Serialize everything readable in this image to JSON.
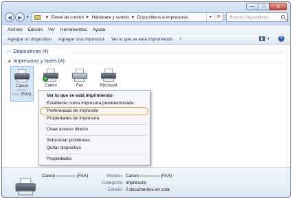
{
  "window": {
    "controls": {
      "minimize": "—",
      "maximize": "□",
      "close": "✕"
    }
  },
  "nav": {
    "back_icon": "back-arrow-icon",
    "forward_icon": "forward-arrow-icon",
    "breadcrumb": [
      "Panel de control",
      "Hardware y sonido",
      "Dispositivos e impresoras"
    ],
    "search_placeholder": "Buscar Dispositivos ..."
  },
  "menubar": [
    "Archivo",
    "Edición",
    "Ver",
    "Herramientas",
    "Ayuda"
  ],
  "toolbar": {
    "buttons": [
      "Agregar un dispositivo",
      "Agregar una impresora",
      "Ver lo que se está imprimiendo"
    ],
    "more": "»",
    "help": "?"
  },
  "groups": {
    "devices": "Dispositivos (4)",
    "printers": "Impresoras y faxes (4)"
  },
  "printers": [
    {
      "label": "Canon",
      "label2": "(FAX)",
      "selected": true
    },
    {
      "label": "Canon",
      "default": true
    },
    {
      "label": "Fax"
    },
    {
      "label": "Microsoft"
    }
  ],
  "context_menu": {
    "items": [
      "Ver lo que se está imprimiendo",
      "Establecer como impresora predeterminada",
      "Preferencias de impresión",
      "Propiedades de impresora",
      "Crear acceso directo",
      "Solucionar problemas",
      "Quitar dispositivo",
      "Propiedades"
    ],
    "highlighted_color": "#f0a23a"
  },
  "details": {
    "name_prefix": "Canon",
    "name_suffix": "(FAX)",
    "model_label": "Modelo:",
    "model_prefix": "Canon",
    "model_suffix": "(FAX)",
    "category_label": "Categoría:",
    "category_value": "Impresora",
    "status_label": "Estado:",
    "status_value": "0 documentos en cola"
  }
}
